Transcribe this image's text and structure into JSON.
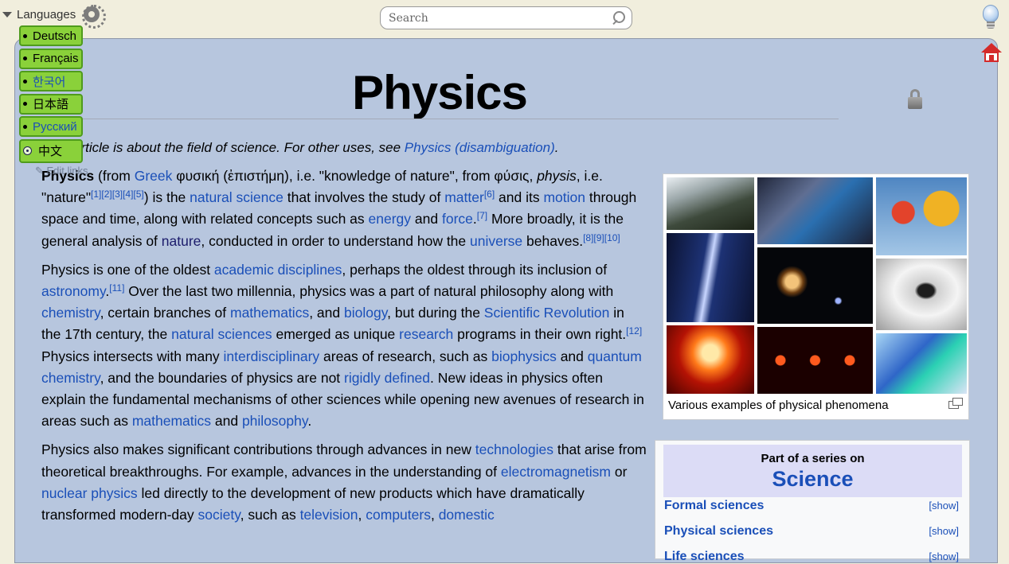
{
  "topbar": {
    "languages_label": "Languages",
    "search_placeholder": "Search"
  },
  "page": {
    "title": "Physics",
    "hatnote_text": "is article is about the field of science. For other uses, see ",
    "hatnote_link": "Physics (disambiguation)",
    "hatnote_end": "."
  },
  "languages": [
    {
      "label": "Deutsch",
      "color": "black"
    },
    {
      "label": "Français",
      "color": "black"
    },
    {
      "label": "한국어",
      "color": "blue"
    },
    {
      "label": "日本語",
      "color": "black"
    },
    {
      "label": "Русский",
      "color": "blue"
    },
    {
      "label": "中文",
      "color": "black"
    }
  ],
  "edit_links": "Edit links",
  "article": {
    "p1": [
      {
        "t": "Physics",
        "b": true
      },
      {
        "t": " (from "
      },
      {
        "t": "Greek",
        "l": true
      },
      {
        "t": " φυσική (ἐπιστήμη), i.e. \"knowledge of nature\", from φύσις, "
      },
      {
        "t": "physis",
        "i": true
      },
      {
        "t": ", i.e. \"nature\""
      },
      {
        "t": "[1][2][3][4][5]",
        "s": true
      },
      {
        "t": ") is the "
      },
      {
        "t": "natural science",
        "l": true
      },
      {
        "t": " that involves the study of "
      },
      {
        "t": "matter",
        "l": true
      },
      {
        "t": "[6]",
        "s": true
      },
      {
        "t": " and its "
      },
      {
        "t": "motion",
        "l": true
      },
      {
        "t": " through space and time, along with related concepts such as "
      },
      {
        "t": "energy",
        "l": true
      },
      {
        "t": " and "
      },
      {
        "t": "force",
        "l": true
      },
      {
        "t": ".",
        "pl": true
      },
      {
        "t": "[7]",
        "s": true
      },
      {
        "t": " More broadly, it is the general analysis of "
      },
      {
        "t": "nature",
        "l": true,
        "v": true
      },
      {
        "t": ", conducted in order to understand how the "
      },
      {
        "t": "universe",
        "l": true
      },
      {
        "t": " behaves."
      },
      {
        "t": "[8][9][10]",
        "s": true
      }
    ],
    "p2": [
      {
        "t": "Physics is one of the oldest "
      },
      {
        "t": "academic disciplines",
        "l": true
      },
      {
        "t": ", perhaps the oldest through its inclusion of "
      },
      {
        "t": "astronomy",
        "l": true
      },
      {
        "t": "."
      },
      {
        "t": "[11]",
        "s": true
      },
      {
        "t": " Over the last two millennia, physics was a part of natural philosophy along with "
      },
      {
        "t": "chemistry",
        "l": true
      },
      {
        "t": ", certain branches of "
      },
      {
        "t": "mathematics",
        "l": true
      },
      {
        "t": ", and "
      },
      {
        "t": "biology",
        "l": true
      },
      {
        "t": ", but during the "
      },
      {
        "t": "Scientific Revolution",
        "l": true
      },
      {
        "t": " in the 17th century, the "
      },
      {
        "t": "natural sciences",
        "l": true
      },
      {
        "t": " emerged as unique "
      },
      {
        "t": "research",
        "l": true
      },
      {
        "t": " programs in their own right."
      },
      {
        "t": "[12]",
        "s": true
      },
      {
        "t": " Physics intersects with many "
      },
      {
        "t": "interdisciplinary",
        "l": true
      },
      {
        "t": " areas of research, such as "
      },
      {
        "t": "biophysics",
        "l": true
      },
      {
        "t": " and "
      },
      {
        "t": "quantum chemistry",
        "l": true
      },
      {
        "t": ", and the boundaries of physics are not "
      },
      {
        "t": "rigidly defined",
        "l": true
      },
      {
        "t": ". New ideas in physics often explain the fundamental mechanisms of other sciences while opening new avenues of research in areas such as "
      },
      {
        "t": "mathematics",
        "l": true
      },
      {
        "t": " and "
      },
      {
        "t": "philosophy",
        "l": true
      },
      {
        "t": "."
      }
    ],
    "p3": [
      {
        "t": "Physics also makes significant contributions through advances in new "
      },
      {
        "t": "technologies",
        "l": true
      },
      {
        "t": " that arise from theoretical breakthroughs. For example, advances in the understanding of "
      },
      {
        "t": "electromagnetism",
        "l": true
      },
      {
        "t": " or "
      },
      {
        "t": "nuclear physics",
        "l": true
      },
      {
        "t": " led directly to the development of new products which have dramatically transformed modern-day "
      },
      {
        "t": "society",
        "l": true
      },
      {
        "t": ", such as "
      },
      {
        "t": "television",
        "l": true
      },
      {
        "t": ", "
      },
      {
        "t": "computers",
        "l": true
      },
      {
        "t": ", "
      },
      {
        "t": "domestic",
        "l": true
      }
    ]
  },
  "infobox": {
    "caption": "Various examples of physical phenomena"
  },
  "series": {
    "part_of": "Part of a series on",
    "name": "Science",
    "rows": [
      {
        "label": "Formal sciences",
        "action": "[show]"
      },
      {
        "label": "Physical sciences",
        "action": "[show]"
      },
      {
        "label": "Life sciences",
        "action": "[show]"
      }
    ]
  },
  "colors": {
    "link": "#1a4fb8",
    "frame_bg": "#b7c6de",
    "chrome_bg": "#f1eedd",
    "lang_green": "#8ad13a"
  }
}
